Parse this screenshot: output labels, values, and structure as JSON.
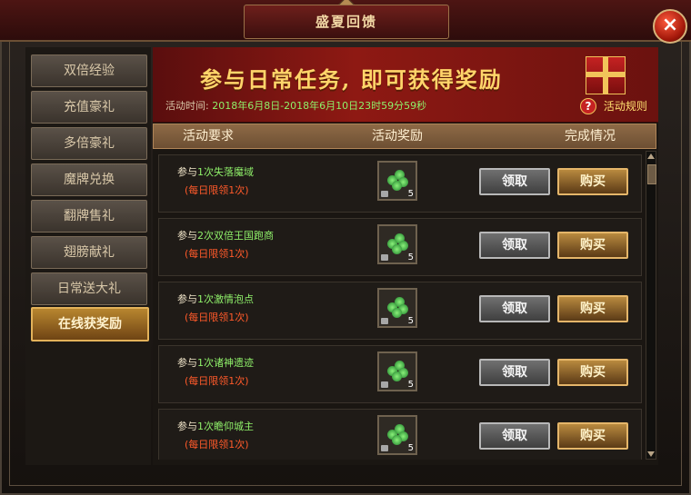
{
  "window": {
    "title": "盛夏回馈"
  },
  "sidebar": {
    "items": [
      {
        "label": "双倍经验"
      },
      {
        "label": "充值豪礼"
      },
      {
        "label": "多倍豪礼"
      },
      {
        "label": "魔牌兑换"
      },
      {
        "label": "翻牌售礼"
      },
      {
        "label": "翅膀献礼"
      },
      {
        "label": "日常送大礼"
      },
      {
        "label": "在线获奖励",
        "active": true
      }
    ]
  },
  "banner": {
    "title": "参与日常任务, 即可获得奖励",
    "time_label": "活动时间:",
    "time_value": "2018年6月8日-2018年6月10日23时59分59秒",
    "rules": "活动规则"
  },
  "table": {
    "headers": {
      "requirement": "活动要求",
      "reward": "活动奖励",
      "status": "完成情况"
    },
    "rows": [
      {
        "prefix": "参与",
        "name": "1次失落魔域",
        "limit": "(每日限领1次)",
        "qty": "5",
        "claim": "领取",
        "buy": "购买"
      },
      {
        "prefix": "参与",
        "name": "2次双倍王国跑商",
        "limit": "(每日限领1次)",
        "qty": "5",
        "claim": "领取",
        "buy": "购买"
      },
      {
        "prefix": "参与",
        "name": "1次激情泡点",
        "limit": "(每日限领1次)",
        "qty": "5",
        "claim": "领取",
        "buy": "购买"
      },
      {
        "prefix": "参与",
        "name": "1次诸神遗迹",
        "limit": "(每日限领1次)",
        "qty": "5",
        "claim": "领取",
        "buy": "购买"
      },
      {
        "prefix": "参与",
        "name": "1次瞻仰城主",
        "limit": "(每日限领1次)",
        "qty": "5",
        "claim": "领取",
        "buy": "购买"
      }
    ]
  },
  "icons": {
    "close": "close-icon",
    "clover": "clover-icon",
    "lock": "lock-icon",
    "help": "question-icon"
  }
}
